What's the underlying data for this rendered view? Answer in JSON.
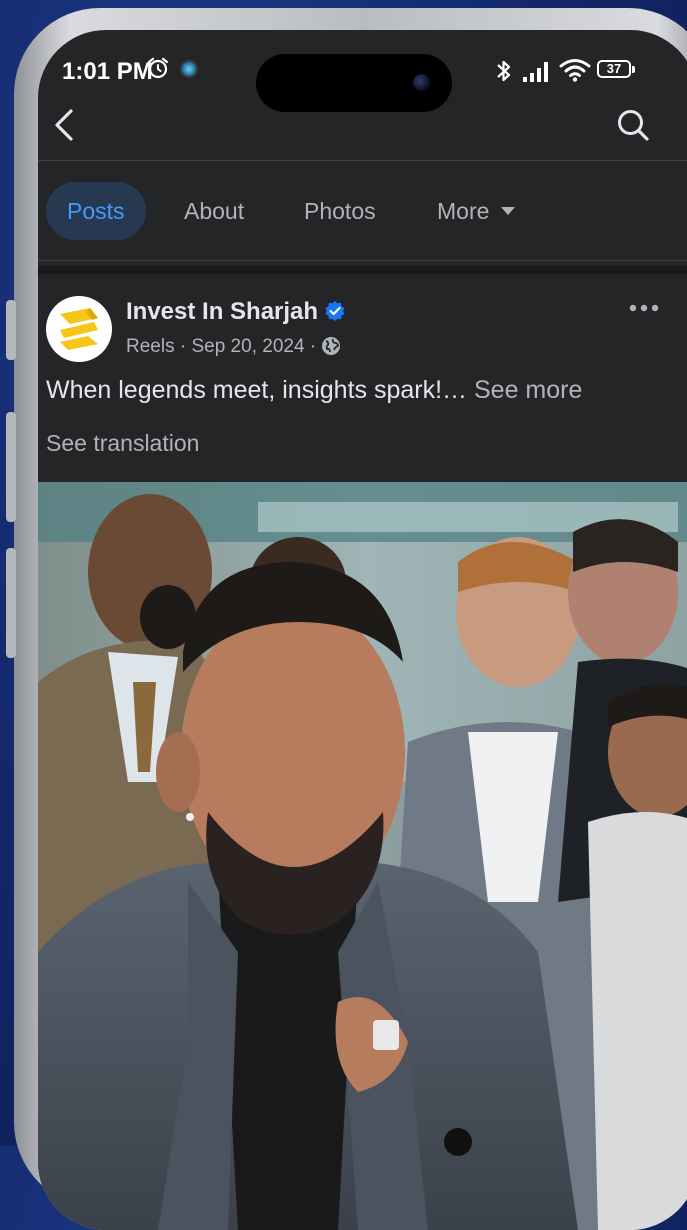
{
  "status_bar": {
    "time": "1:01 PM",
    "battery": "37"
  },
  "tabs": [
    {
      "label": "Posts",
      "active": true
    },
    {
      "label": "About",
      "active": false
    },
    {
      "label": "Photos",
      "active": false
    },
    {
      "label": "More",
      "active": false
    }
  ],
  "post": {
    "page_name": "Invest In Sharjah",
    "type": "Reels",
    "date": "Sep 20, 2024",
    "caption": "When legends meet, insights spark!…",
    "see_more": "See more",
    "see_translation": "See translation"
  },
  "icons": {
    "back": "back-arrow-icon",
    "search": "search-icon",
    "verified": "verified-badge-icon",
    "audience": "globe-icon",
    "options": "more-options-icon"
  },
  "colors": {
    "background": "#242526",
    "active_tab_bg": "#263951",
    "active_tab_text": "#4599ff",
    "verified_blue": "#1877f2",
    "brand_yellow": "#f5c518"
  }
}
